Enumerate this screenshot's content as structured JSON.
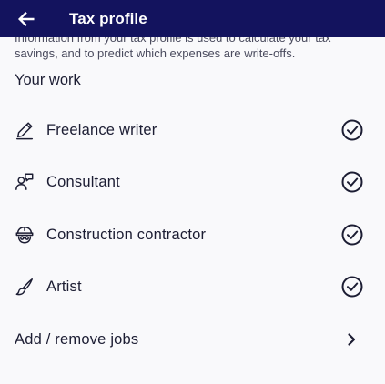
{
  "header": {
    "title": "Tax profile",
    "back_icon": "arrow-left-icon"
  },
  "intro": {
    "text": "Information from your tax profile is used to calculate your tax savings, and to predict which expenses are write-offs."
  },
  "section": {
    "title": "Your work"
  },
  "jobs": [
    {
      "label": "Freelance writer",
      "icon": "pen-icon",
      "selected": true
    },
    {
      "label": "Consultant",
      "icon": "consultant-icon",
      "selected": true
    },
    {
      "label": "Construction contractor",
      "icon": "hard-hat-icon",
      "selected": true
    },
    {
      "label": "Artist",
      "icon": "paintbrush-icon",
      "selected": true
    }
  ],
  "add_remove": {
    "label": "Add / remove jobs",
    "icon": "chevron-right-icon"
  },
  "colors": {
    "header_bg": "#13135e",
    "background": "#f9f9fb",
    "text": "#1c1d33"
  }
}
